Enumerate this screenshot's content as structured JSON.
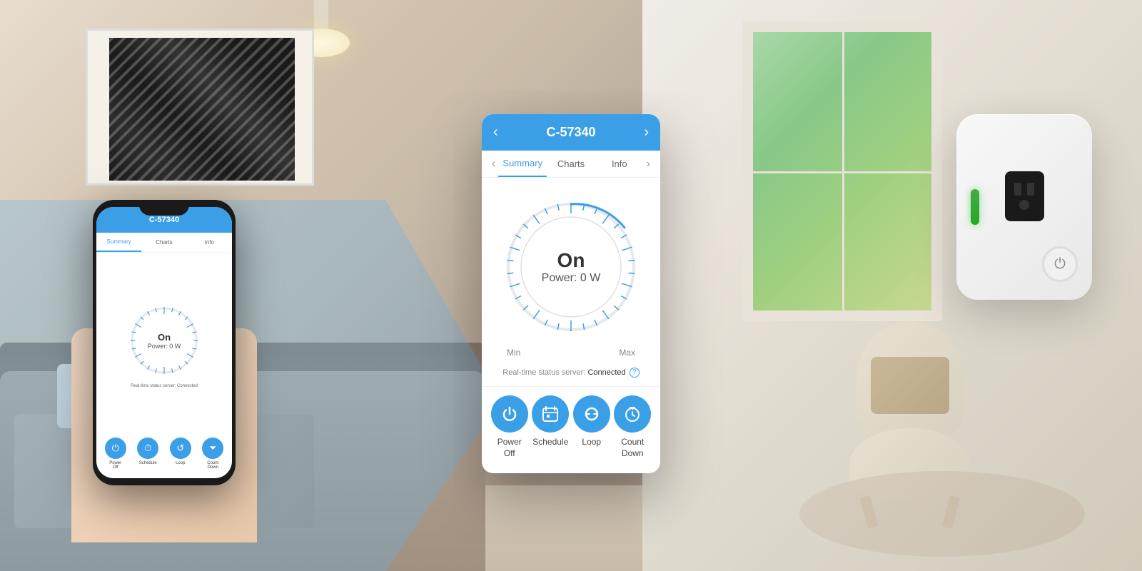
{
  "background": {
    "left_color": "#c8b8a8",
    "right_color": "#e8e2d8"
  },
  "phone": {
    "app": {
      "header": {
        "back_icon": "‹",
        "title": "C-57340",
        "forward_icon": "›"
      },
      "tabs": {
        "left_arrow": "‹",
        "right_arrow": "›",
        "items": [
          {
            "label": "Summary",
            "active": true
          },
          {
            "label": "Charts",
            "active": false
          },
          {
            "label": "Info",
            "active": false
          }
        ]
      },
      "gauge": {
        "status": "On",
        "power": "Power: 0 W",
        "min_label": "Min",
        "max_label": "Max"
      },
      "realtime_status": "Real-time status server: Connected",
      "buttons": [
        {
          "icon": "⏻",
          "label": "Power\nOff",
          "key": "power-off"
        },
        {
          "icon": "⏱",
          "label": "Schedule",
          "key": "schedule"
        },
        {
          "icon": "↺",
          "label": "Loop",
          "key": "loop"
        },
        {
          "icon": "⏷",
          "label": "Count\nDown",
          "key": "countdown"
        }
      ]
    }
  },
  "mini_phone": {
    "tabs": [
      "Summary",
      "Charts",
      "Info"
    ],
    "gauge": {
      "status": "On",
      "power": "Power: 0 W"
    },
    "status": "Real-time status server: Connected",
    "buttons": [
      {
        "label": "Power\nOff"
      },
      {
        "label": "Schedule"
      },
      {
        "label": "Loop"
      },
      {
        "label": "Count\nDown"
      }
    ]
  },
  "smart_plug": {
    "indicator_color": "#22aa22",
    "power_icon": "⏻"
  }
}
